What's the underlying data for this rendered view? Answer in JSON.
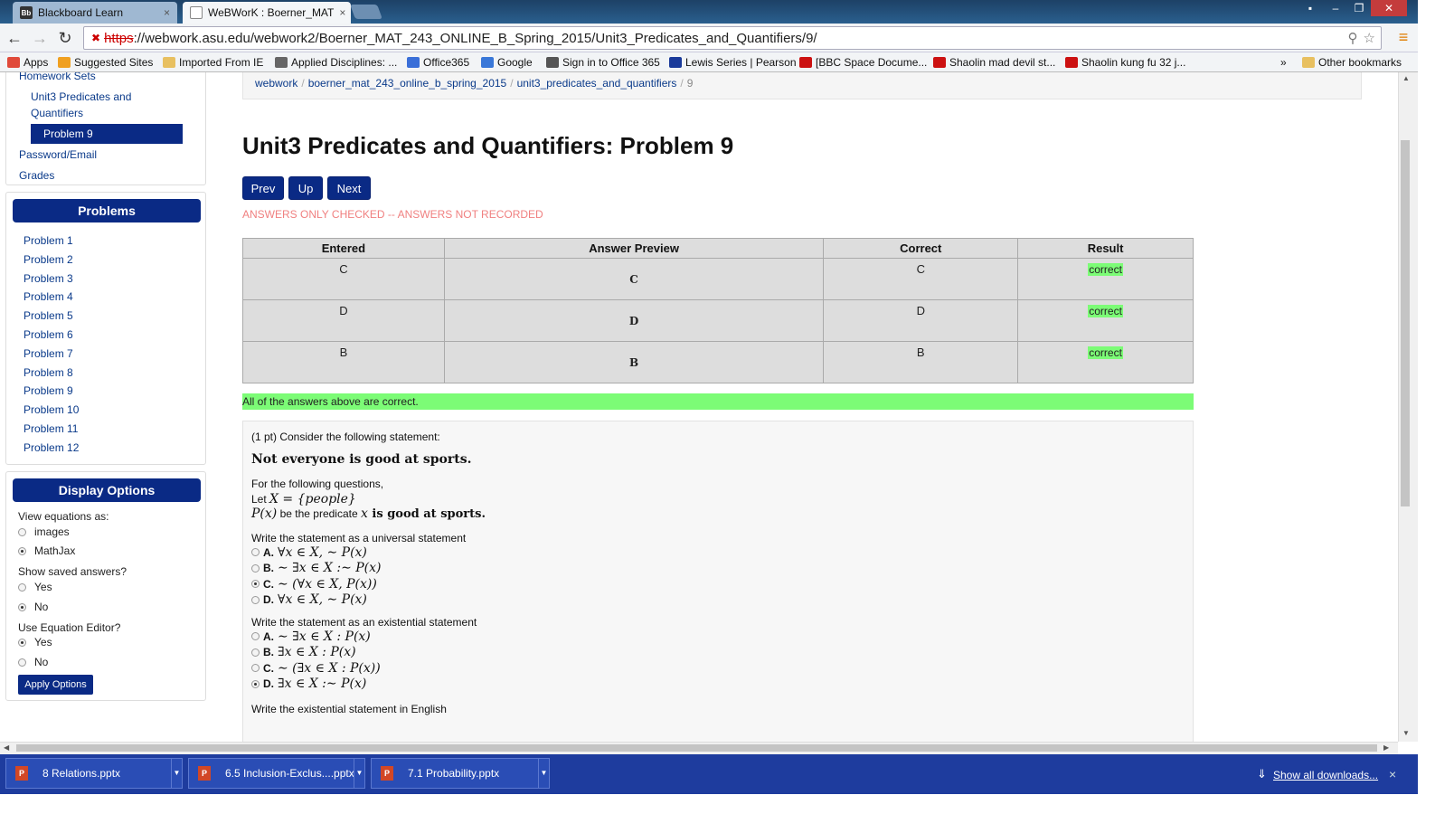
{
  "browser": {
    "tabs": [
      {
        "favicon": "Bb",
        "label": "Blackboard Learn",
        "close": "×"
      },
      {
        "favicon": "",
        "label": "WeBWorK : Boerner_MAT",
        "close": "×"
      }
    ],
    "url_scheme": "https",
    "url_rest": "://webwork.asu.edu/webwork2/Boerner_MAT_243_ONLINE_B_Spring_2015/Unit3_Predicates_and_Quantifiers/9/",
    "window_buttons": [
      "▪",
      "–",
      "❐",
      "✕"
    ],
    "nav": {
      "back": "←",
      "forward": "→",
      "reload": "↻",
      "menu": "≡",
      "star": "☆",
      "zoom": "⚲"
    },
    "bookmarks": [
      {
        "label": "Apps",
        "icon": "apps-icon",
        "color": "#e04a3a"
      },
      {
        "label": "Suggested Sites",
        "icon": "suggested-sites-icon",
        "color": "#f0a020"
      },
      {
        "label": "Imported From IE",
        "icon": "folder-icon",
        "color": "#e8c060"
      },
      {
        "label": "Applied Disciplines: ...",
        "icon": "site-icon",
        "color": "#666"
      },
      {
        "label": "Office365",
        "icon": "office-icon",
        "color": "#3a6fd8"
      },
      {
        "label": "Google",
        "icon": "google-icon",
        "color": "#3a78d8"
      },
      {
        "label": "Sign in to Office 365",
        "icon": "office365-icon",
        "color": "#555"
      },
      {
        "label": "Lewis Series | Pearson",
        "icon": "pearson-icon",
        "color": "#1a3a9a"
      },
      {
        "label": "[BBC Space Docume...",
        "icon": "youtube-icon",
        "color": "#cc1111"
      },
      {
        "label": "Shaolin mad devil st...",
        "icon": "youtube-icon",
        "color": "#cc1111"
      },
      {
        "label": "Shaolin kung fu 32 j...",
        "icon": "youtube-icon",
        "color": "#cc1111"
      }
    ],
    "overflow": "»",
    "other_bookmarks": "Other bookmarks"
  },
  "sidebar": {
    "homework_sets_label": "Homework Sets",
    "current_set_line1": "Unit3 Predicates and",
    "current_set_line2": "Quantifiers",
    "current_problem": "Problem 9",
    "password_email": "Password/Email",
    "grades": "Grades",
    "problems_header": "Problems",
    "problems": [
      "Problem 1",
      "Problem 2",
      "Problem 3",
      "Problem 4",
      "Problem 5",
      "Problem 6",
      "Problem 7",
      "Problem 8",
      "Problem 9",
      "Problem 10",
      "Problem 11",
      "Problem 12"
    ],
    "display_options_header": "Display Options",
    "view_equations_label": "View equations as:",
    "view_equations_options": [
      "images",
      "MathJax"
    ],
    "view_equations_selected": "MathJax",
    "show_saved_label": "Show saved answers?",
    "show_saved_options": [
      "Yes",
      "No"
    ],
    "show_saved_selected": "No",
    "use_editor_label": "Use Equation Editor?",
    "use_editor_options": [
      "Yes",
      "No"
    ],
    "use_editor_selected": "Yes",
    "apply_button": "Apply Options"
  },
  "main": {
    "breadcrumbs": [
      "webwork",
      "boerner_mat_243_online_b_spring_2015",
      "unit3_predicates_and_quantifiers",
      "9"
    ],
    "breadcrumb_sep": "/",
    "title": "Unit3 Predicates and Quantifiers: Problem 9",
    "nav_buttons": [
      "Prev",
      "Up",
      "Next"
    ],
    "status_message": "ANSWERS ONLY CHECKED -- ANSWERS NOT RECORDED",
    "results_table": {
      "headers": [
        "Entered",
        "Answer Preview",
        "Correct",
        "Result"
      ],
      "rows": [
        {
          "entered": "C",
          "preview": "C",
          "correct": "C",
          "result": "correct"
        },
        {
          "entered": "D",
          "preview": "D",
          "correct": "D",
          "result": "correct"
        },
        {
          "entered": "B",
          "preview": "B",
          "correct": "B",
          "result": "correct"
        }
      ],
      "result_color": "#7cfc76"
    },
    "summary": "All of the answers above are correct.",
    "problem": {
      "intro": "(1 pt) Consider the following statement:",
      "statement": "Not everyone is good at sports.",
      "for_following": "For the following questions,",
      "let_prefix": "Let ",
      "let_math": "X = {people}",
      "predicate_math": "P(x)",
      "predicate_mid": " be the predicate ",
      "predicate_var": "x",
      "predicate_tail": " is good at sports.",
      "q1": "Write the statement as a universal statement",
      "q1_options": [
        {
          "letter": "A.",
          "math": "∀x ∈ X, ∼ P(x)"
        },
        {
          "letter": "B.",
          "math": "∼ ∃x ∈ X :∼ P(x)"
        },
        {
          "letter": "C.",
          "math": "∼ (∀x ∈ X, P(x))"
        },
        {
          "letter": "D.",
          "math": "∀x ∈ X, ∼ P(x)"
        }
      ],
      "q1_selected": "C.",
      "q2": "Write the statement as an existential statement",
      "q2_options": [
        {
          "letter": "A.",
          "math": "∼ ∃x ∈ X : P(x)"
        },
        {
          "letter": "B.",
          "math": "∃x ∈ X : P(x)"
        },
        {
          "letter": "C.",
          "math": "∼ (∃x ∈ X : P(x))"
        },
        {
          "letter": "D.",
          "math": "∃x ∈ X :∼ P(x)"
        }
      ],
      "q2_selected": "D.",
      "q3": "Write the existential statement in English"
    }
  },
  "downloads": {
    "items": [
      "8 Relations.pptx",
      "6.5 Inclusion-Exclus....pptx",
      "7.1 Probability.pptx"
    ],
    "file_icon": "P",
    "show_all": "Show all downloads...",
    "close": "×"
  },
  "colors": {
    "brand_navy": "#0a2a85",
    "correct_green": "#7cfc76",
    "warning_pink": "#f08080",
    "downloads_bar": "#1e3c9e"
  }
}
